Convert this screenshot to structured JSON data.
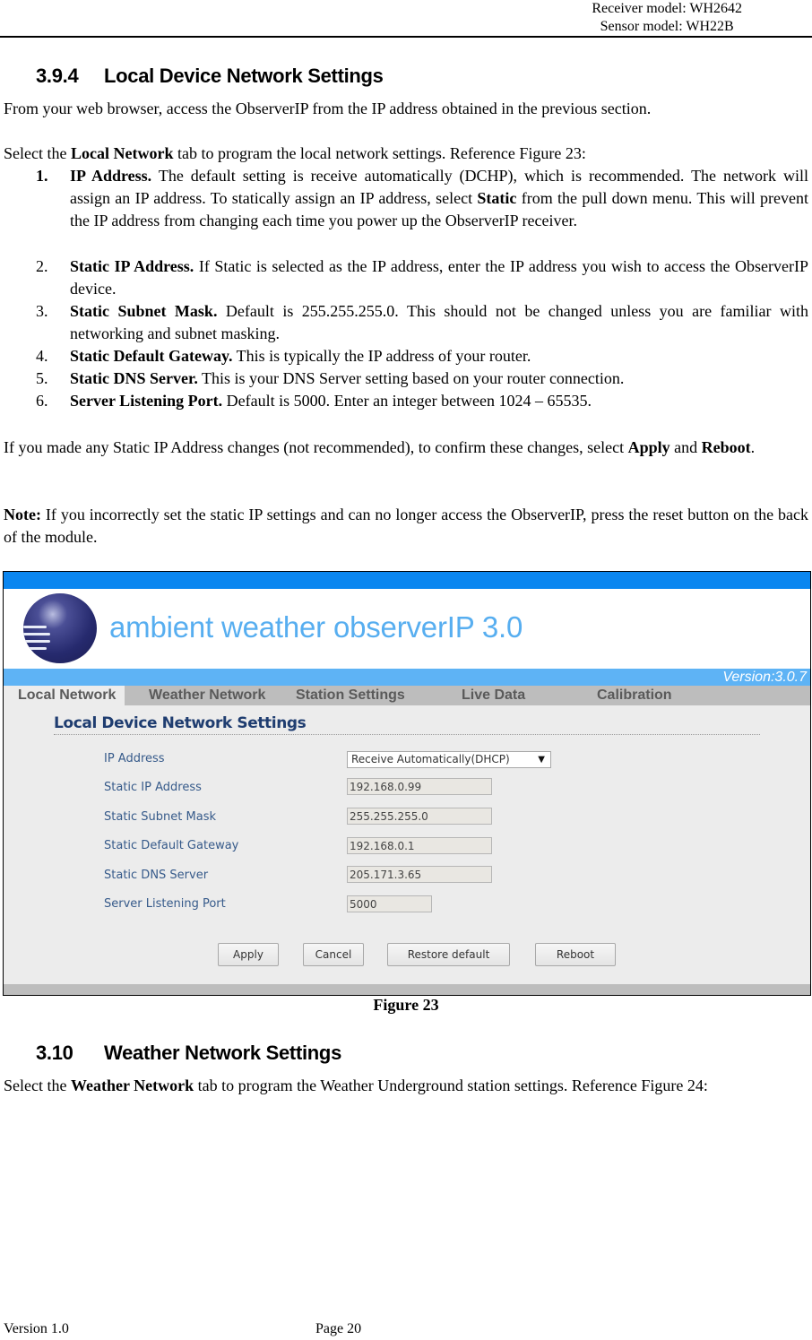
{
  "header": {
    "receiver_model": "Receiver model: WH2642",
    "sensor_model": "Sensor model: WH22B"
  },
  "section_394": {
    "number": "3.9.4",
    "title": "Local Device Network Settings",
    "intro": "From your web browser, access the ObserverIP from the IP address obtained in the previous section.",
    "select_pre": "Select the ",
    "select_bold": "Local Network",
    "select_post": " tab to program the local network settings.    Reference Figure 23:",
    "items": [
      {
        "n": "1.",
        "bold": "IP Address.",
        "text_a": " The default setting is receive automatically (DCHP), which is recommended. The network will assign an IP address. To statically assign an IP address, select ",
        "bold2": "Static",
        "text_b": " from the pull down menu. This will prevent the IP address from changing each time you power up the ObserverIP receiver."
      },
      {
        "n": "2.",
        "bold": "Static IP Address.",
        "text_a": " If Static is selected as the IP address, enter the IP address you wish to access the ObserverIP device."
      },
      {
        "n": "3.",
        "bold": "Static Subnet Mask.",
        "text_a": " Default is 255.255.255.0. This should not be changed unless you are familiar with networking and subnet masking."
      },
      {
        "n": "4.",
        "bold": "Static Default Gateway.",
        "text_a": " This is typically the IP address of your router."
      },
      {
        "n": "5.",
        "bold": "Static DNS Server.",
        "text_a": " This is your DNS Server setting based on your router connection."
      },
      {
        "n": "6.",
        "bold": "Server Listening Port.",
        "text_a": " Default is 5000. Enter an integer between 1024 – 65535."
      }
    ],
    "confirm_pre": "If you made any Static IP Address changes (not recommended), to confirm these changes, select ",
    "confirm_b1": "Apply",
    "confirm_mid": " and ",
    "confirm_b2": "Reboot",
    "confirm_post": ".",
    "note_bold": "Note:",
    "note_text": " If you incorrectly set the static IP settings and can no longer access the ObserverIP, press the reset button on the back of the module."
  },
  "figure": {
    "brand": "ambient weather observerIP 3.0",
    "version": "Version:3.0.7",
    "tabs": [
      "Local Network",
      "Weather Network",
      "Station Settings",
      "Live Data",
      "Calibration"
    ],
    "active_tab": "Local Network",
    "section_title": "Local Device Network Settings",
    "fields": [
      {
        "label": "IP Address",
        "type": "select",
        "value": "Receive Automatically(DHCP)"
      },
      {
        "label": "Static IP Address",
        "type": "input",
        "value": "192.168.0.99"
      },
      {
        "label": "Static Subnet Mask",
        "type": "input",
        "value": "255.255.255.0"
      },
      {
        "label": "Static Default Gateway",
        "type": "input",
        "value": "192.168.0.1"
      },
      {
        "label": "Static DNS Server",
        "type": "input",
        "value": "205.171.3.65"
      },
      {
        "label": "Server Listening Port",
        "type": "input",
        "value": "5000"
      }
    ],
    "buttons": [
      "Apply",
      "Cancel",
      "Restore default",
      "Reboot"
    ],
    "caption": "Figure 23",
    "colors": {
      "top_bar": "#0a86f0",
      "version_bar": "#5eb3f5",
      "brand_text": "#57aef0",
      "label_text": "#365a8a",
      "title_text": "#1f3d70"
    }
  },
  "section_310": {
    "number": "3.10",
    "title": "Weather Network Settings",
    "text_pre": "Select the ",
    "text_bold": "Weather Network",
    "text_post": " tab to program the Weather Underground station settings.   Reference Figure 24:"
  },
  "footer": {
    "version": "Version 1.0",
    "page": "Page 20"
  }
}
